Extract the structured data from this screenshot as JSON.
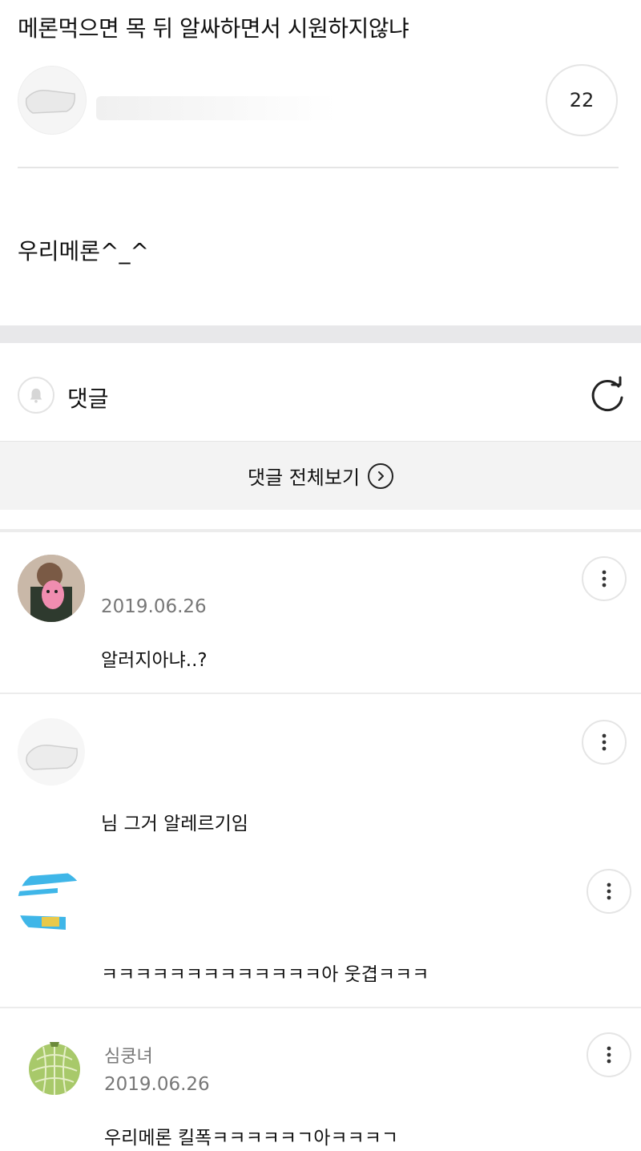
{
  "post": {
    "title": "메론먹으면 목 뒤 알싸하면서 시원하지않냐",
    "count": "22",
    "body": "우리메론^_^"
  },
  "comments_section": {
    "label": "댓글",
    "view_all_label": "댓글 전체보기"
  },
  "comments": [
    {
      "name": "",
      "date": "2019.06.26",
      "text": "알러지아냐..?"
    },
    {
      "name": "",
      "date": "",
      "text": "님 그거 알레르기임"
    },
    {
      "name": "",
      "date": "",
      "text": "ㅋㅋㅋㅋㅋㅋㅋㅋㅋㅋㅋㅋㅋ아 웃겹ㅋㅋㅋ"
    },
    {
      "name": "심쿵녀",
      "date": "2019.06.26",
      "text": "우리메론 킬폭ㅋㅋㅋㅋㅋㄱ아ㅋㅋㅋㄱ"
    }
  ],
  "icons": {
    "bell": "bell-icon",
    "refresh": "refresh-icon",
    "chevron": "chevron-right-icon",
    "more": "more-vertical-icon"
  }
}
